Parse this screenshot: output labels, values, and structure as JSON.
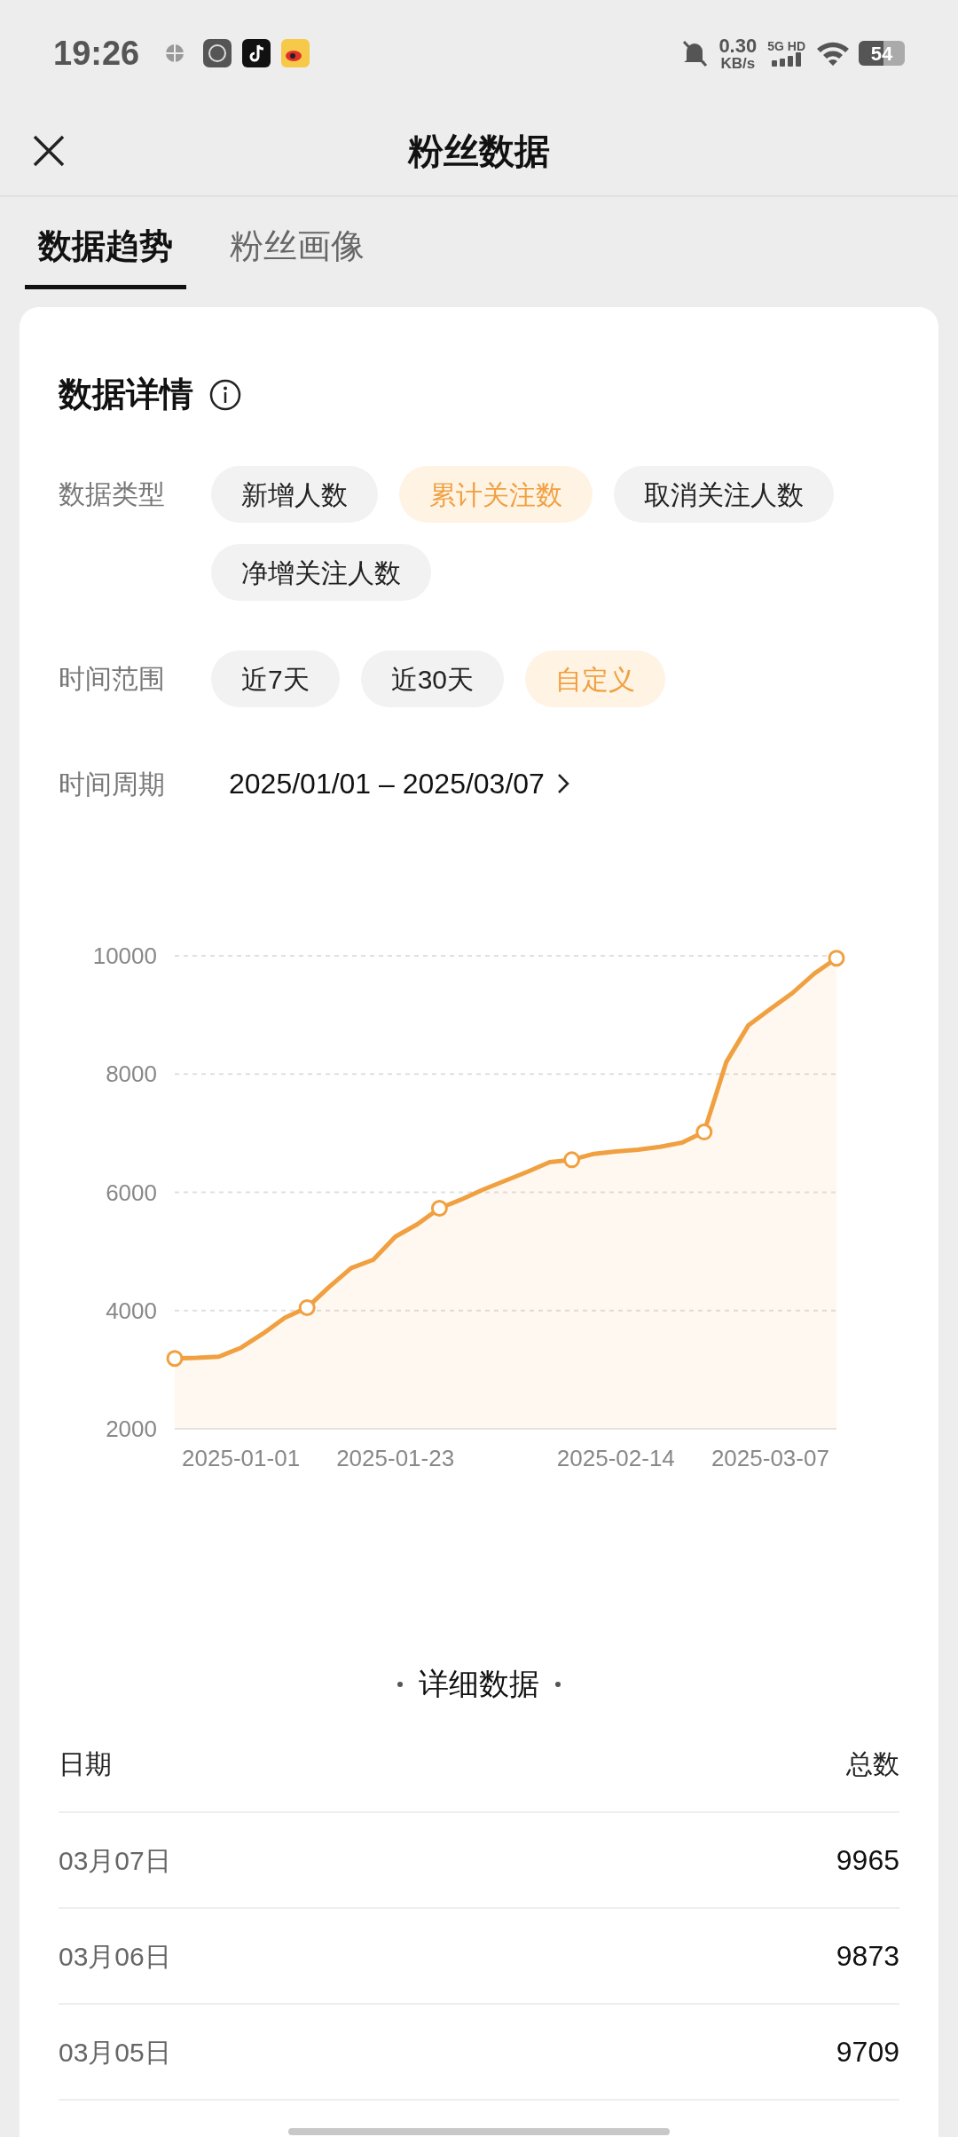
{
  "status_bar": {
    "time": "19:26",
    "network_speed": "0.30",
    "network_unit": "KB/s",
    "network_type": "5G HD",
    "battery": "54"
  },
  "header": {
    "title": "粉丝数据"
  },
  "tabs": [
    {
      "label": "数据趋势",
      "selected": true
    },
    {
      "label": "粉丝画像",
      "selected": false
    }
  ],
  "card": {
    "title": "数据详情",
    "data_type": {
      "label": "数据类型",
      "options": [
        {
          "label": "新增人数",
          "selected": false
        },
        {
          "label": "累计关注数",
          "selected": true
        },
        {
          "label": "取消关注人数",
          "selected": false
        },
        {
          "label": "净增关注人数",
          "selected": false
        }
      ]
    },
    "time_range": {
      "label": "时间范围",
      "options": [
        {
          "label": "近7天",
          "selected": false
        },
        {
          "label": "近30天",
          "selected": false
        },
        {
          "label": "自定义",
          "selected": true
        }
      ]
    },
    "period": {
      "label": "时间周期",
      "value": "2025/01/01 – 2025/03/07"
    },
    "chart_data": {
      "type": "area",
      "categories": [
        null,
        null,
        null,
        "2025-01-01",
        null,
        null,
        null,
        null,
        null,
        null,
        "2025-01-23",
        null,
        null,
        null,
        null,
        null,
        null,
        null,
        null,
        null,
        "2025-02-14",
        null,
        null,
        null,
        null,
        null,
        null,
        "2025-03-07",
        null,
        null,
        null
      ],
      "grid": true,
      "series": [
        {
          "color": "#f0a040",
          "values": [
            3190,
            3200,
            3220,
            3370,
            3610,
            3880,
            4050,
            4400,
            4720,
            4860,
            5250,
            5460,
            5730,
            5880,
            6050,
            6200,
            6350,
            6510,
            6550,
            6650,
            6690,
            6720,
            6770,
            6840,
            7020,
            8200,
            8820,
            9100,
            9370,
            9700,
            9960
          ]
        }
      ],
      "ylim": [
        2000,
        10000
      ],
      "yticks": [
        2000,
        4000,
        6000,
        8000,
        10000
      ]
    },
    "details": {
      "title": "详细数据",
      "columns": [
        "日期",
        "总数"
      ],
      "rows": [
        [
          "03月07日",
          "9965"
        ],
        [
          "03月06日",
          "9873"
        ],
        [
          "03月05日",
          "9709"
        ]
      ]
    }
  }
}
